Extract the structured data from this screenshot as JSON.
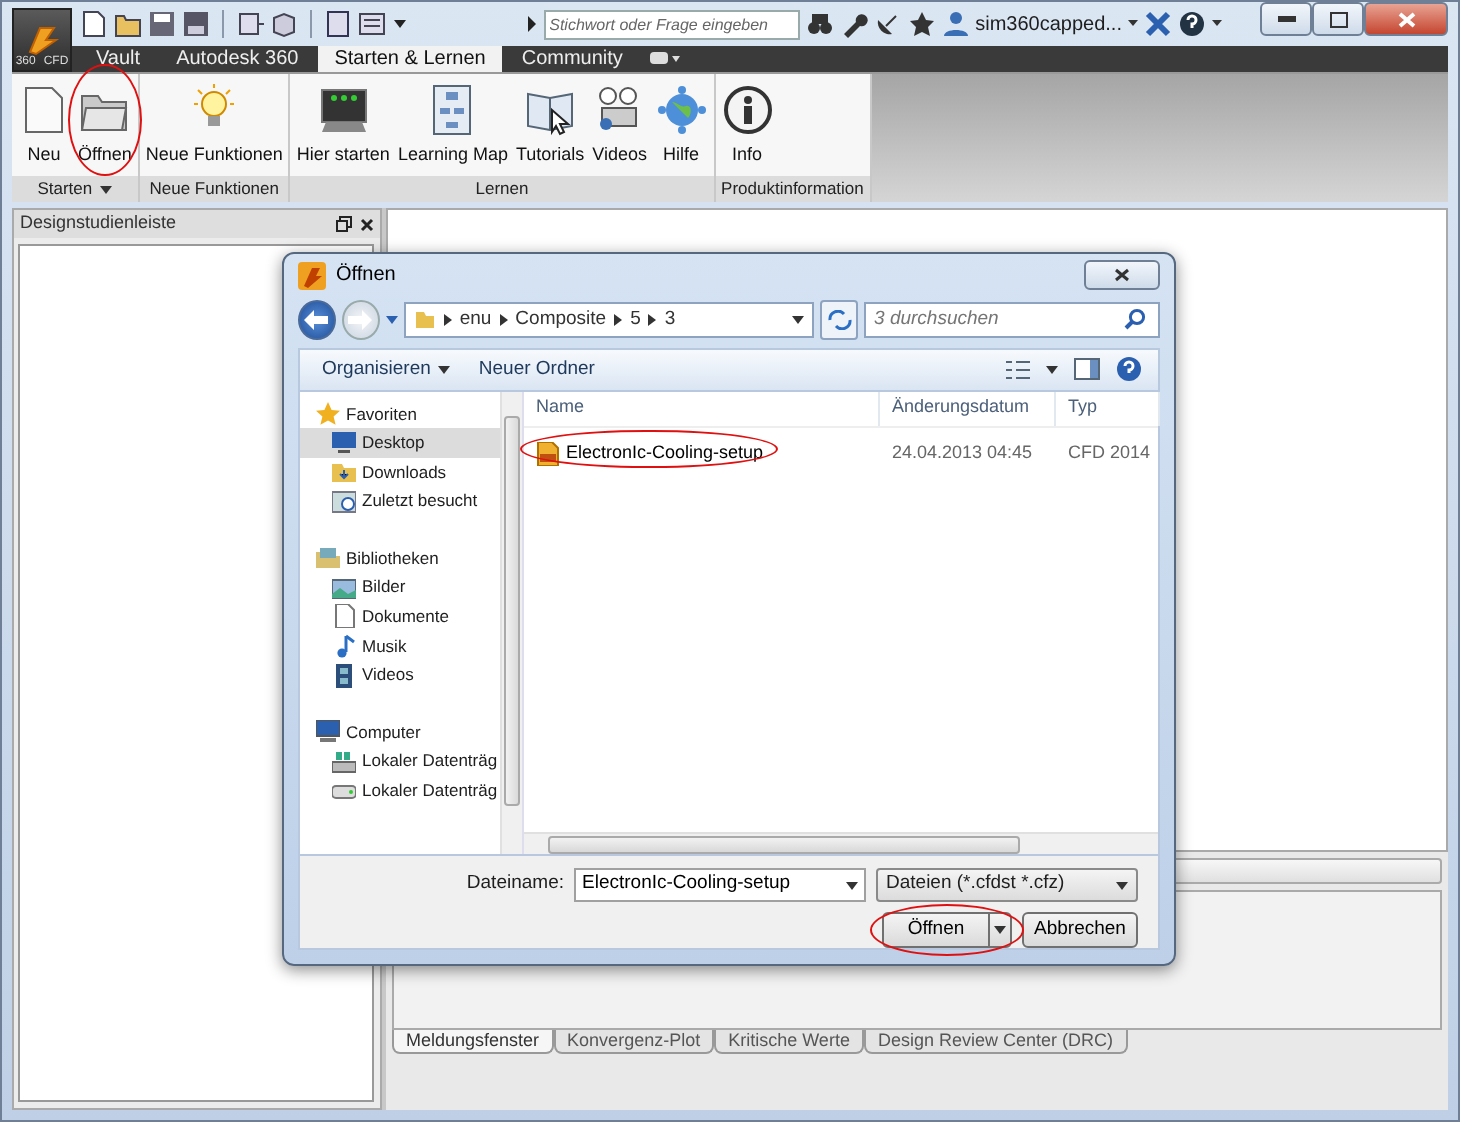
{
  "app": {
    "logo_labels": [
      "360",
      "CFD"
    ],
    "search": {
      "placeholder": "Stichwort oder Frage eingeben"
    },
    "user": "sim360capped..."
  },
  "tabs": [
    {
      "label": "Vault",
      "selected": false
    },
    {
      "label": "Autodesk 360",
      "selected": false
    },
    {
      "label": "Starten & Lernen",
      "selected": true
    },
    {
      "label": "Community",
      "selected": false
    }
  ],
  "ribbon": {
    "groups": [
      {
        "label": "Starten",
        "has_menu": true,
        "items": [
          {
            "label": "Neu",
            "circled": false
          },
          {
            "label": "Öffnen",
            "circled": true
          }
        ]
      },
      {
        "label": "Neue Funktionen",
        "has_menu": false,
        "items": [
          {
            "label": "Neue Funktionen",
            "circled": false
          }
        ]
      },
      {
        "label": "Lernen",
        "has_menu": false,
        "items": [
          {
            "label": "Hier starten",
            "circled": false
          },
          {
            "label": "Learning Map",
            "circled": false
          },
          {
            "label": "Tutorials",
            "circled": false
          },
          {
            "label": "Videos",
            "circled": false
          },
          {
            "label": "Hilfe",
            "circled": false
          }
        ]
      },
      {
        "label": "Produktinformation",
        "has_menu": false,
        "items": [
          {
            "label": "Info",
            "circled": false
          }
        ]
      }
    ]
  },
  "design_panel": {
    "title": "Designstudienleiste"
  },
  "output_tabs": [
    {
      "label": "Meldungsfenster",
      "selected": true
    },
    {
      "label": "Konvergenz-Plot",
      "selected": false
    },
    {
      "label": "Kritische Werte",
      "selected": false
    },
    {
      "label": "Design Review Center (DRC)",
      "selected": false
    }
  ],
  "dialog": {
    "title": "Öffnen",
    "path": [
      "enu",
      "Composite",
      "5",
      "3"
    ],
    "search_placeholder": "3 durchsuchen",
    "toolbar": [
      {
        "label": "Organisieren",
        "has_menu": true
      },
      {
        "label": "Neuer Ordner",
        "has_menu": false
      }
    ],
    "nav": [
      {
        "label": "Favoriten",
        "selected": false,
        "children": [
          {
            "label": "Desktop",
            "selected": true
          },
          {
            "label": "Downloads",
            "selected": false
          },
          {
            "label": "Zuletzt besucht",
            "selected": false
          }
        ]
      },
      {
        "label": "Bibliotheken",
        "selected": false,
        "children": [
          {
            "label": "Bilder",
            "selected": false
          },
          {
            "label": "Dokumente",
            "selected": false
          },
          {
            "label": "Musik",
            "selected": false
          },
          {
            "label": "Videos",
            "selected": false
          }
        ]
      },
      {
        "label": "Computer",
        "selected": false,
        "children": [
          {
            "label": "Lokaler Datenträg",
            "selected": false
          },
          {
            "label": "Lokaler Datenträg",
            "selected": false
          }
        ]
      }
    ],
    "columns": [
      "Name",
      "Änderungsdatum",
      "Typ"
    ],
    "files": [
      {
        "name": "ElectronIc-Cooling-setup",
        "date": "24.04.2013 04:45",
        "type": "CFD 2014",
        "selected": false,
        "circled": true
      }
    ],
    "filename_label": "Dateiname:",
    "filename": "ElectronIc-Cooling-setup",
    "filter": "Dateien (*.cfdst *.cfz)",
    "buttons": [
      {
        "label": "Öffnen",
        "kind": "split",
        "circled": true
      },
      {
        "label": "Abbrechen",
        "kind": "plain",
        "circled": false
      }
    ]
  }
}
